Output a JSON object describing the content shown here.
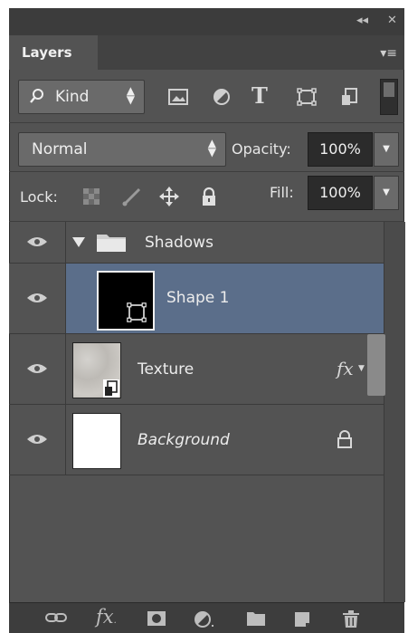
{
  "window": {
    "collapse_glyph": "◂◂",
    "close_glyph": "✕"
  },
  "tab": {
    "title": "Layers",
    "menu_glyph": "▾≡"
  },
  "filter": {
    "kind_label": "Kind",
    "icons": [
      "image-filter-icon",
      "adjustment-filter-icon",
      "type-filter-icon",
      "shape-filter-icon",
      "smart-object-filter-icon"
    ],
    "type_glyph": "T"
  },
  "blend": {
    "mode": "Normal",
    "opacity_label": "Opacity:",
    "opacity_value": "100%"
  },
  "lock": {
    "label": "Lock:",
    "fill_label": "Fill:",
    "fill_value": "100%"
  },
  "layers": [
    {
      "name": "Shadows",
      "kind": "group",
      "expanded": true,
      "visible": true
    },
    {
      "name": "Shape 1",
      "kind": "shape",
      "selected": true,
      "visible": true
    },
    {
      "name": "Texture",
      "kind": "smart-object",
      "fx_label": "fx",
      "visible": true
    },
    {
      "name": "Background",
      "kind": "background",
      "locked": true,
      "visible": true
    }
  ],
  "bottom_icons": [
    "link-layers-icon",
    "fx-icon",
    "layer-mask-icon",
    "adjustment-layer-icon",
    "new-group-icon",
    "new-layer-icon",
    "delete-layer-icon"
  ],
  "colors": {
    "panel": "#535353",
    "selected_row": "#5b6e8a",
    "field_bg": "#2b2b2b"
  }
}
